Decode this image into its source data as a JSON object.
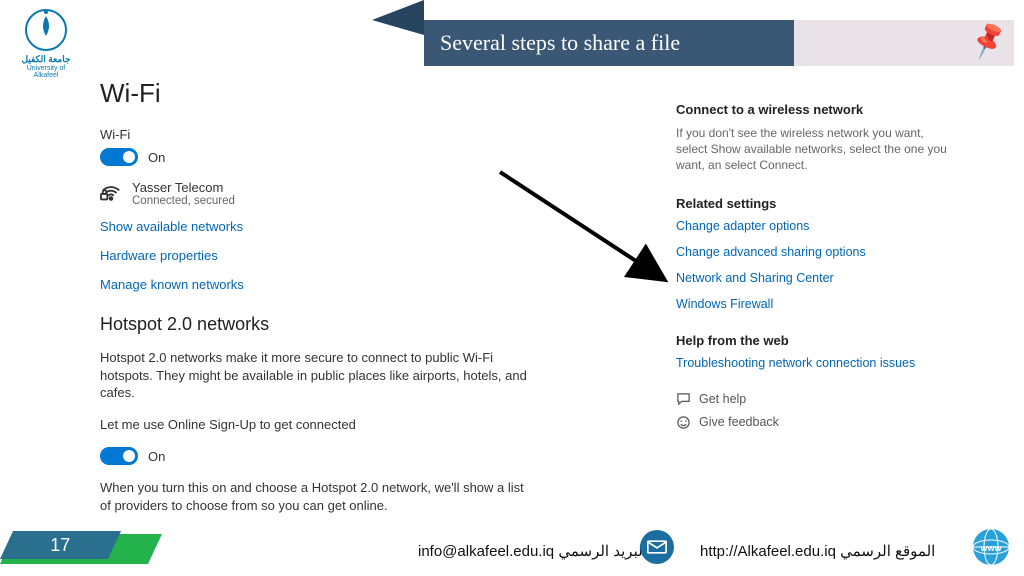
{
  "slide": {
    "title": "Several steps to share a file",
    "page_number": "17",
    "email_line": "البريد الرسمي   info@alkafeel.edu.iq",
    "url_line": "الموقع الرسمي http://Alkafeel.edu.iq"
  },
  "logo": {
    "ar": "جامعة الكفيل",
    "en": "University of Alkafeel"
  },
  "wifi": {
    "heading": "Wi-Fi",
    "switch_label": "Wi-Fi",
    "switch_state": "On",
    "network": {
      "name": "Yasser Telecom",
      "status": "Connected, secured"
    },
    "links": {
      "show_networks": "Show available networks",
      "hw_props": "Hardware properties",
      "manage_known": "Manage known networks"
    }
  },
  "hotspot": {
    "heading": "Hotspot 2.0 networks",
    "desc": "Hotspot 2.0 networks make it more secure to connect to public Wi-Fi hotspots. They might be available in public places like airports, hotels, and cafes.",
    "switch_label": "Let me use Online Sign-Up to get connected",
    "switch_state": "On",
    "note": "When you turn this on and choose a Hotspot 2.0 network, we'll show a list of providers to choose from so you can get online."
  },
  "right": {
    "connect_heading": "Connect to a wireless network",
    "connect_body": "If you don't see the wireless network you want, select Show available networks, select the one you want, an select Connect.",
    "related_heading": "Related settings",
    "links": {
      "adapter": "Change adapter options",
      "advanced_sharing": "Change advanced sharing options",
      "network_center": "Network and Sharing Center",
      "firewall": "Windows Firewall"
    },
    "helpweb_heading": "Help from the web",
    "helpweb_link": "Troubleshooting network connection issues",
    "get_help": "Get help",
    "feedback": "Give feedback"
  }
}
